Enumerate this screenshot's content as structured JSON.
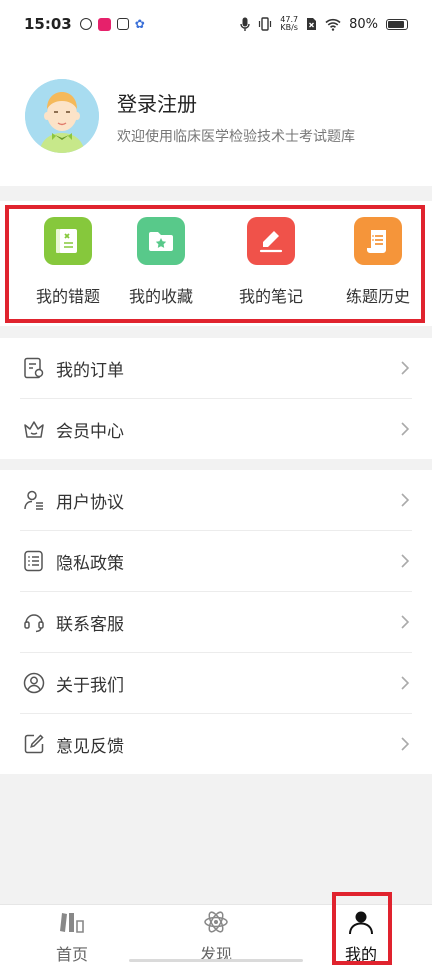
{
  "status_bar": {
    "time": "15:03",
    "net_speed_value": "47.7",
    "net_speed_unit": "KB/s",
    "battery": "80%"
  },
  "profile": {
    "title": "登录注册",
    "subtitle": "欢迎使用临床医学检验技术士考试题库"
  },
  "quick_actions": [
    {
      "label": "我的错题",
      "icon": "book-x-icon",
      "color": "#86c83c"
    },
    {
      "label": "我的收藏",
      "icon": "star-folder-icon",
      "color": "#58c98a"
    },
    {
      "label": "我的笔记",
      "icon": "pencil-icon",
      "color": "#f0524a"
    },
    {
      "label": "练题历史",
      "icon": "scroll-list-icon",
      "color": "#f5953a"
    }
  ],
  "menu_group_1": [
    {
      "label": "我的订单",
      "icon": "order-icon"
    },
    {
      "label": "会员中心",
      "icon": "crown-icon"
    }
  ],
  "menu_group_2": [
    {
      "label": "用户协议",
      "icon": "user-agreement-icon"
    },
    {
      "label": "隐私政策",
      "icon": "policy-list-icon"
    },
    {
      "label": "联系客服",
      "icon": "headset-icon"
    },
    {
      "label": "关于我们",
      "icon": "user-circle-icon"
    },
    {
      "label": "意见反馈",
      "icon": "edit-feedback-icon"
    }
  ],
  "tabbar": {
    "tabs": [
      {
        "label": "首页",
        "icon": "books-icon",
        "active": false
      },
      {
        "label": "发现",
        "icon": "atom-icon",
        "active": false
      },
      {
        "label": "我的",
        "icon": "person-icon",
        "active": true
      }
    ]
  },
  "colors": {
    "highlight": "#e0232e",
    "background": "#f2f2f2"
  }
}
